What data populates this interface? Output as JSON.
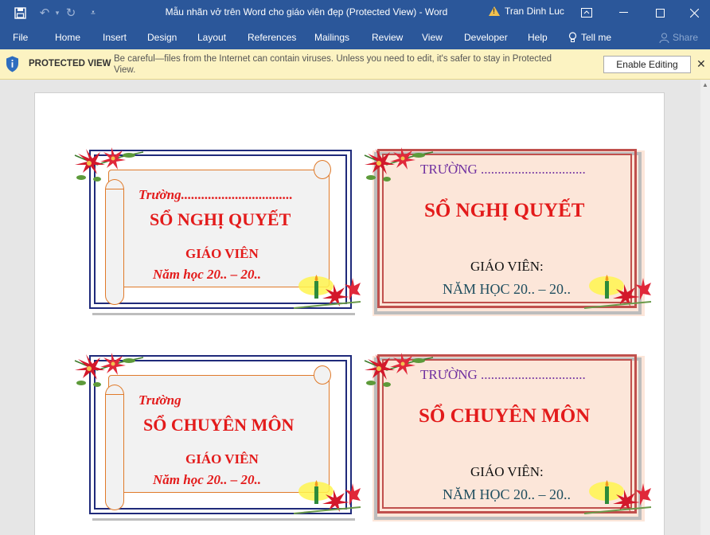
{
  "window": {
    "title": "Mẫu nhãn vở trên Word cho giáo viên đẹp (Protected View)  -  Word",
    "user": "Tran Dinh Luc"
  },
  "ribbon": {
    "tabs": [
      "File",
      "Home",
      "Insert",
      "Design",
      "Layout",
      "References",
      "Mailings",
      "Review",
      "View",
      "Developer",
      "Help"
    ],
    "tell_me": "Tell me",
    "share": "Share"
  },
  "protected_view": {
    "label": "PROTECTED VIEW",
    "message": "Be careful—files from the Internet can contain viruses. Unless you need to edit, it's safer to stay in Protected View.",
    "enable_button": "Enable Editing"
  },
  "labels": {
    "nghi_quyet_scroll": {
      "school": "Trường.................................",
      "title": "SỔ NGHỊ QUYẾT",
      "teacher": "GIÁO VIÊN",
      "year": "Năm học 20.. – 20.."
    },
    "nghi_quyet_pink": {
      "school": "TRƯỜNG ...............................",
      "title": "SỔ NGHỊ QUYẾT",
      "teacher": "GIÁO VIÊN:",
      "year": "NĂM HỌC 20.. – 20.."
    },
    "chuyen_mon_scroll": {
      "school": "Trường",
      "title": "SỔ CHUYÊN MÔN",
      "teacher": "GIÁO VIÊN",
      "year": "Năm học 20.. – 20.."
    },
    "chuyen_mon_pink": {
      "school": "TRƯỜNG ...............................",
      "title": "SỔ CHUYÊN MÔN",
      "teacher": "GIÁO VIÊN:",
      "year": "NĂM HỌC 20.. – 20.."
    }
  },
  "colors": {
    "word_blue": "#2b579a",
    "protected_yellow": "#fcf3c2",
    "label_red": "#e31b1b",
    "frame_navy": "#1f2a7a",
    "scroll_orange": "#e07a2a",
    "pink_fill": "#fce6d9",
    "pink_frame": "#c0504d",
    "school_purple": "#7030a0"
  }
}
